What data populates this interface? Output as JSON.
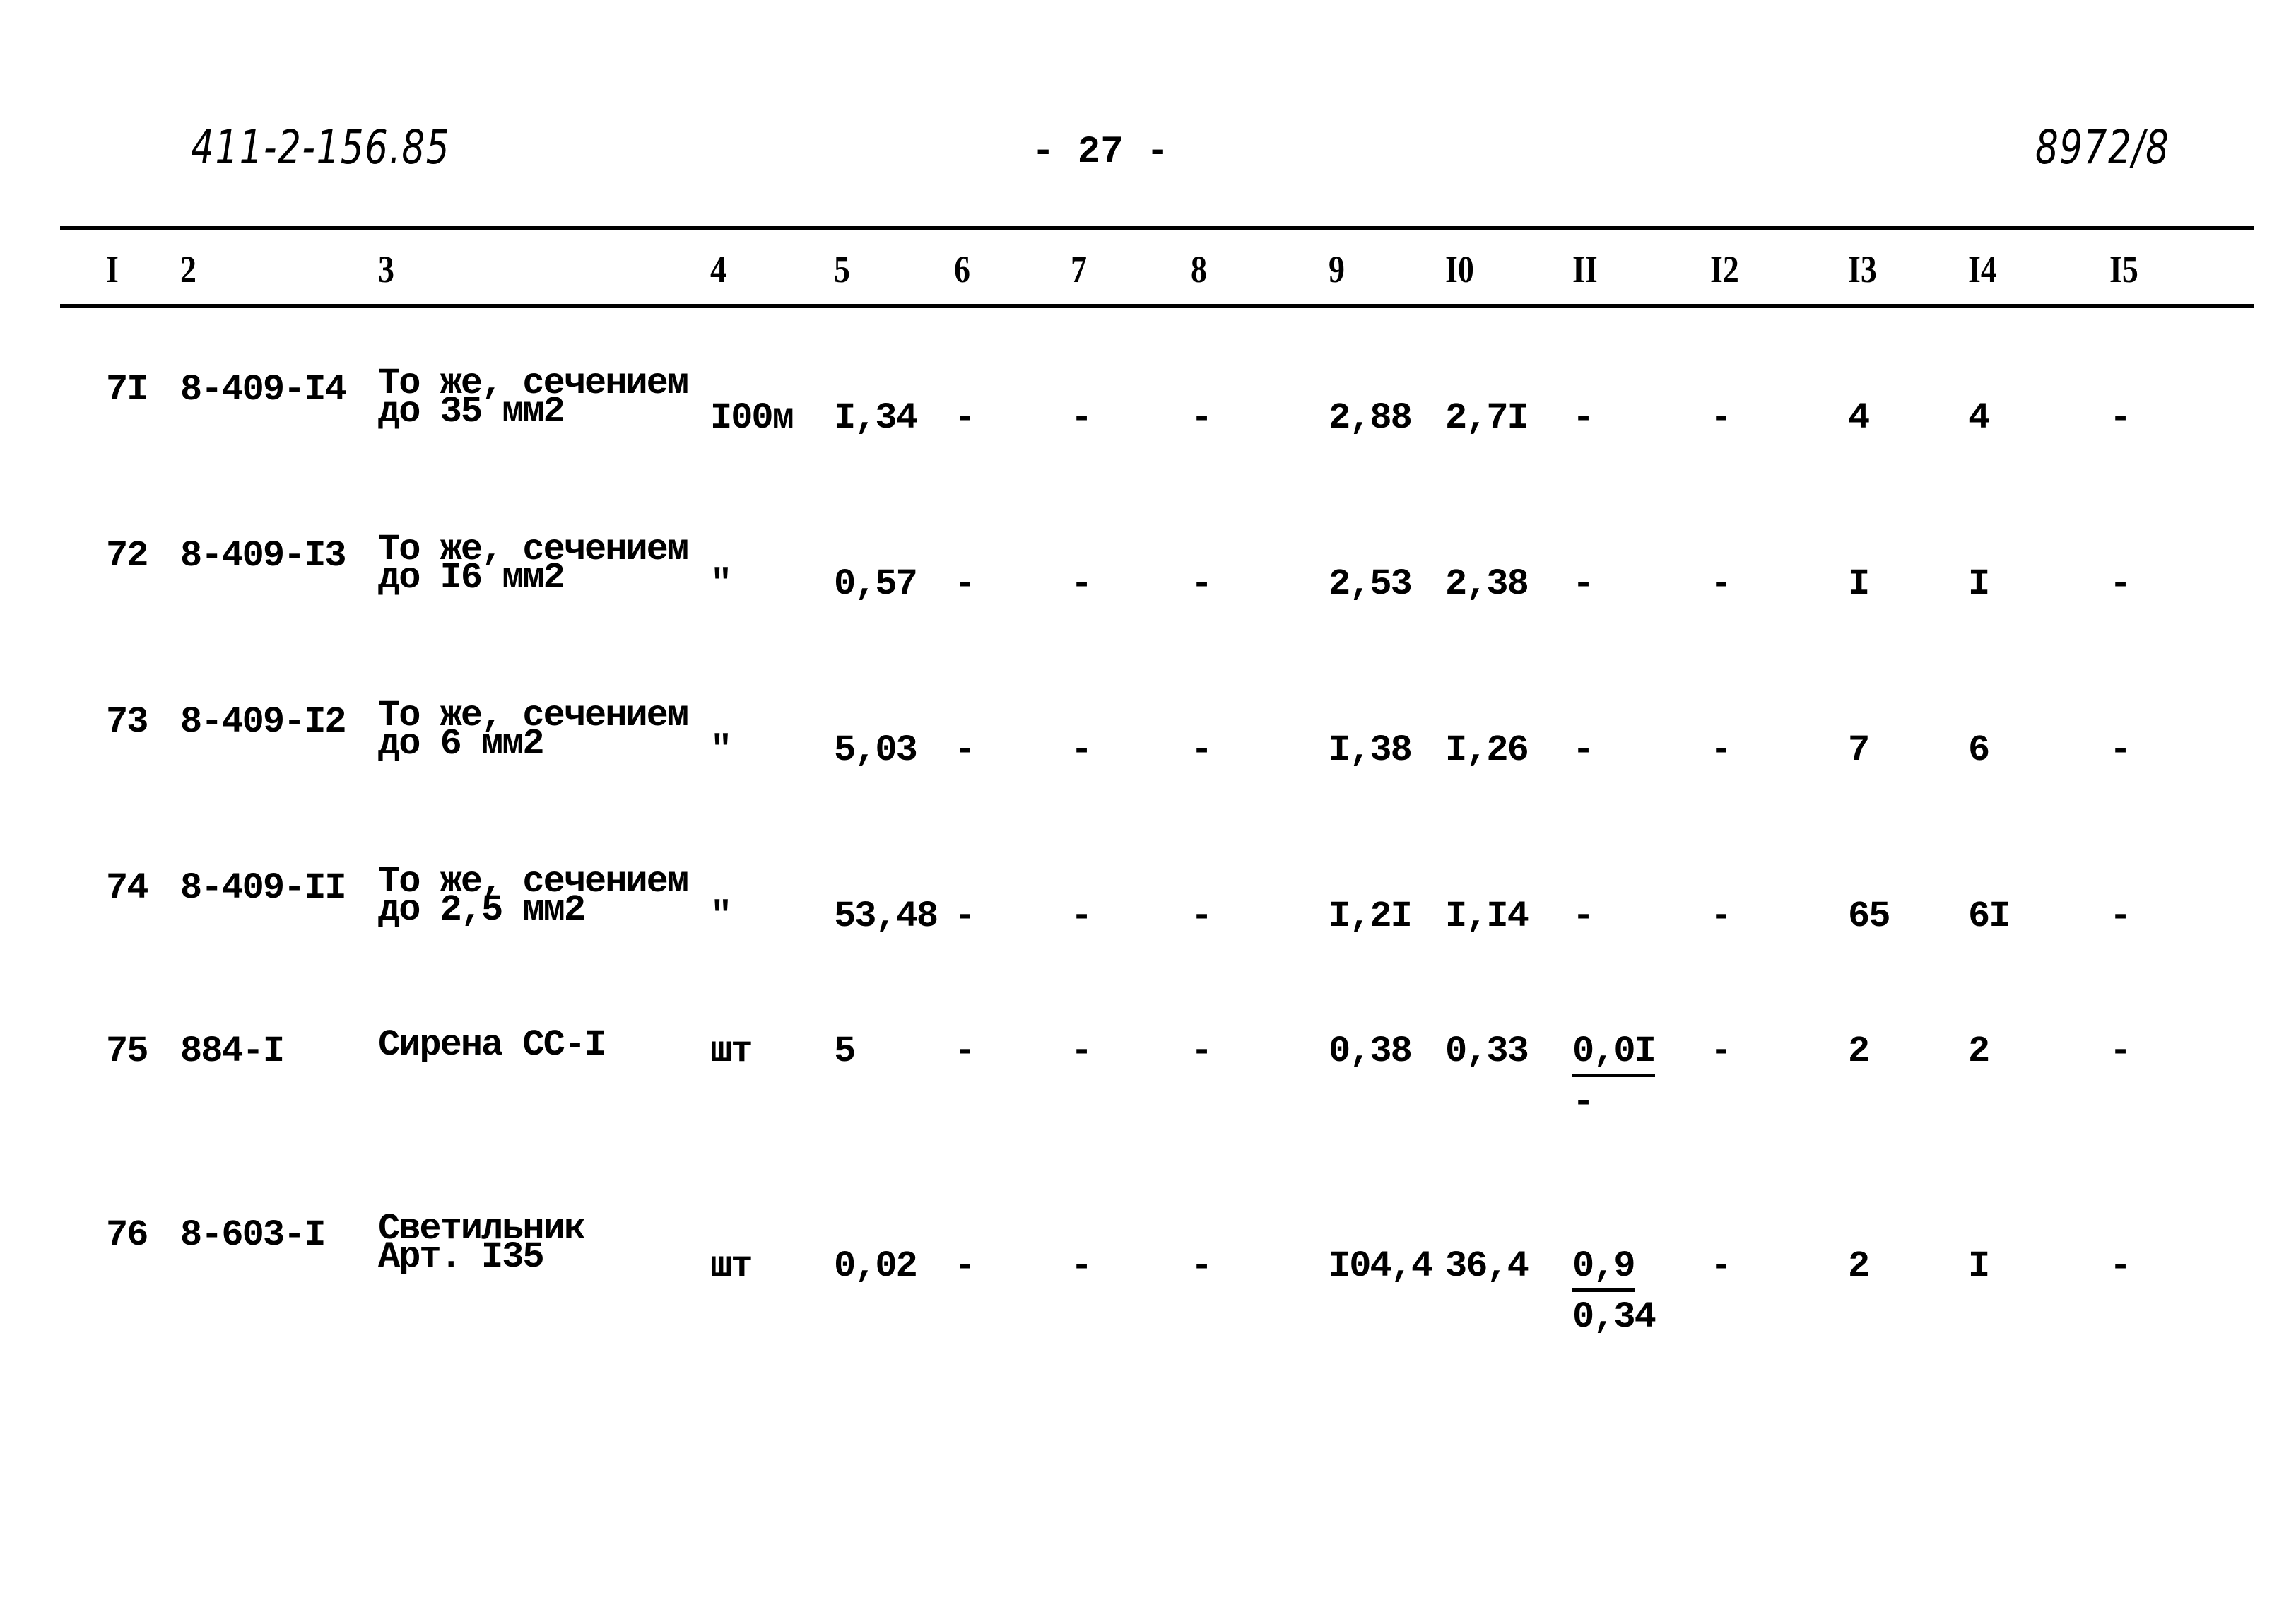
{
  "header": {
    "doc_code": "411-2-156.85",
    "page_number": "- 27 -",
    "inventory_number": "8972/8"
  },
  "table": {
    "column_headers": [
      "I",
      "2",
      "3",
      "4",
      "5",
      "6",
      "7",
      "8",
      "9",
      "I0",
      "II",
      "I2",
      "I3",
      "I4",
      "I5"
    ],
    "rows": [
      {
        "c1": "7I",
        "c2": "8-409-I4",
        "c3": [
          "То же, сечением",
          "до 35 мм2"
        ],
        "c4": "I00м",
        "c5": "I,34",
        "c6": "-",
        "c7": "-",
        "c8": "-",
        "c9": "2,88",
        "c10": "2,7I",
        "c11": "-",
        "c11b": "",
        "c12": "-",
        "c13": "4",
        "c14": "4",
        "c15": "-"
      },
      {
        "c1": "72",
        "c2": "8-409-I3",
        "c3": [
          "То же, сечением",
          "до I6 мм2"
        ],
        "c4": "\"",
        "c5": "0,57",
        "c6": "-",
        "c7": "-",
        "c8": "-",
        "c9": "2,53",
        "c10": "2,38",
        "c11": "-",
        "c11b": "",
        "c12": "-",
        "c13": "I",
        "c14": "I",
        "c15": "-"
      },
      {
        "c1": "73",
        "c2": "8-409-I2",
        "c3": [
          "То же, сечением",
          "до 6 мм2"
        ],
        "c4": "\"",
        "c5": "5,03",
        "c6": "-",
        "c7": "-",
        "c8": "-",
        "c9": "I,38",
        "c10": "I,26",
        "c11": "-",
        "c11b": "",
        "c12": "-",
        "c13": "7",
        "c14": "6",
        "c15": "-"
      },
      {
        "c1": "74",
        "c2": "8-409-II",
        "c3": [
          "То же, сечением",
          "до 2,5 мм2"
        ],
        "c4": "\"",
        "c5": "53,48",
        "c6": "-",
        "c7": "-",
        "c8": "-",
        "c9": "I,2I",
        "c10": "I,I4",
        "c11": "-",
        "c11b": "",
        "c12": "-",
        "c13": "65",
        "c14": "6I",
        "c15": "-"
      },
      {
        "c1": "75",
        "c2": "884-I",
        "c3": [
          "Сирена СС-I"
        ],
        "c4": "шт",
        "c5": "5",
        "c6": "-",
        "c7": "-",
        "c8": "-",
        "c9": "0,38",
        "c10": "0,33",
        "c11": "0,0I",
        "c11b": "-",
        "c12": "-",
        "c13": "2",
        "c14": "2",
        "c15": "-"
      },
      {
        "c1": "76",
        "c2": "8-603-I",
        "c3": [
          "Светильник",
          "Арт. I35"
        ],
        "c4": "шт",
        "c5": "0,02",
        "c6": "-",
        "c7": "-",
        "c8": "-",
        "c9": "I04,4",
        "c10": "36,4",
        "c11": "0,9",
        "c11b": "0,34",
        "c12": "-",
        "c13": "2",
        "c14": "I",
        "c15": "-"
      }
    ]
  }
}
